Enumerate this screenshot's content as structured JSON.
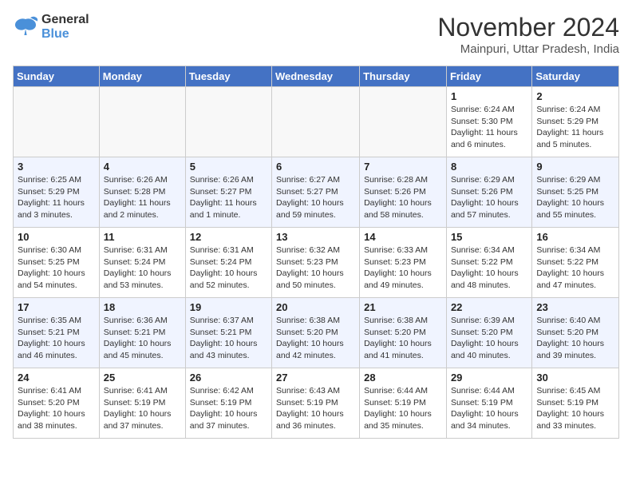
{
  "logo": {
    "line1": "General",
    "line2": "Blue"
  },
  "title": "November 2024",
  "location": "Mainpuri, Uttar Pradesh, India",
  "weekdays": [
    "Sunday",
    "Monday",
    "Tuesday",
    "Wednesday",
    "Thursday",
    "Friday",
    "Saturday"
  ],
  "weeks": [
    [
      {
        "day": "",
        "detail": ""
      },
      {
        "day": "",
        "detail": ""
      },
      {
        "day": "",
        "detail": ""
      },
      {
        "day": "",
        "detail": ""
      },
      {
        "day": "",
        "detail": ""
      },
      {
        "day": "1",
        "detail": "Sunrise: 6:24 AM\nSunset: 5:30 PM\nDaylight: 11 hours and 6 minutes."
      },
      {
        "day": "2",
        "detail": "Sunrise: 6:24 AM\nSunset: 5:29 PM\nDaylight: 11 hours and 5 minutes."
      }
    ],
    [
      {
        "day": "3",
        "detail": "Sunrise: 6:25 AM\nSunset: 5:29 PM\nDaylight: 11 hours and 3 minutes."
      },
      {
        "day": "4",
        "detail": "Sunrise: 6:26 AM\nSunset: 5:28 PM\nDaylight: 11 hours and 2 minutes."
      },
      {
        "day": "5",
        "detail": "Sunrise: 6:26 AM\nSunset: 5:27 PM\nDaylight: 11 hours and 1 minute."
      },
      {
        "day": "6",
        "detail": "Sunrise: 6:27 AM\nSunset: 5:27 PM\nDaylight: 10 hours and 59 minutes."
      },
      {
        "day": "7",
        "detail": "Sunrise: 6:28 AM\nSunset: 5:26 PM\nDaylight: 10 hours and 58 minutes."
      },
      {
        "day": "8",
        "detail": "Sunrise: 6:29 AM\nSunset: 5:26 PM\nDaylight: 10 hours and 57 minutes."
      },
      {
        "day": "9",
        "detail": "Sunrise: 6:29 AM\nSunset: 5:25 PM\nDaylight: 10 hours and 55 minutes."
      }
    ],
    [
      {
        "day": "10",
        "detail": "Sunrise: 6:30 AM\nSunset: 5:25 PM\nDaylight: 10 hours and 54 minutes."
      },
      {
        "day": "11",
        "detail": "Sunrise: 6:31 AM\nSunset: 5:24 PM\nDaylight: 10 hours and 53 minutes."
      },
      {
        "day": "12",
        "detail": "Sunrise: 6:31 AM\nSunset: 5:24 PM\nDaylight: 10 hours and 52 minutes."
      },
      {
        "day": "13",
        "detail": "Sunrise: 6:32 AM\nSunset: 5:23 PM\nDaylight: 10 hours and 50 minutes."
      },
      {
        "day": "14",
        "detail": "Sunrise: 6:33 AM\nSunset: 5:23 PM\nDaylight: 10 hours and 49 minutes."
      },
      {
        "day": "15",
        "detail": "Sunrise: 6:34 AM\nSunset: 5:22 PM\nDaylight: 10 hours and 48 minutes."
      },
      {
        "day": "16",
        "detail": "Sunrise: 6:34 AM\nSunset: 5:22 PM\nDaylight: 10 hours and 47 minutes."
      }
    ],
    [
      {
        "day": "17",
        "detail": "Sunrise: 6:35 AM\nSunset: 5:21 PM\nDaylight: 10 hours and 46 minutes."
      },
      {
        "day": "18",
        "detail": "Sunrise: 6:36 AM\nSunset: 5:21 PM\nDaylight: 10 hours and 45 minutes."
      },
      {
        "day": "19",
        "detail": "Sunrise: 6:37 AM\nSunset: 5:21 PM\nDaylight: 10 hours and 43 minutes."
      },
      {
        "day": "20",
        "detail": "Sunrise: 6:38 AM\nSunset: 5:20 PM\nDaylight: 10 hours and 42 minutes."
      },
      {
        "day": "21",
        "detail": "Sunrise: 6:38 AM\nSunset: 5:20 PM\nDaylight: 10 hours and 41 minutes."
      },
      {
        "day": "22",
        "detail": "Sunrise: 6:39 AM\nSunset: 5:20 PM\nDaylight: 10 hours and 40 minutes."
      },
      {
        "day": "23",
        "detail": "Sunrise: 6:40 AM\nSunset: 5:20 PM\nDaylight: 10 hours and 39 minutes."
      }
    ],
    [
      {
        "day": "24",
        "detail": "Sunrise: 6:41 AM\nSunset: 5:20 PM\nDaylight: 10 hours and 38 minutes."
      },
      {
        "day": "25",
        "detail": "Sunrise: 6:41 AM\nSunset: 5:19 PM\nDaylight: 10 hours and 37 minutes."
      },
      {
        "day": "26",
        "detail": "Sunrise: 6:42 AM\nSunset: 5:19 PM\nDaylight: 10 hours and 37 minutes."
      },
      {
        "day": "27",
        "detail": "Sunrise: 6:43 AM\nSunset: 5:19 PM\nDaylight: 10 hours and 36 minutes."
      },
      {
        "day": "28",
        "detail": "Sunrise: 6:44 AM\nSunset: 5:19 PM\nDaylight: 10 hours and 35 minutes."
      },
      {
        "day": "29",
        "detail": "Sunrise: 6:44 AM\nSunset: 5:19 PM\nDaylight: 10 hours and 34 minutes."
      },
      {
        "day": "30",
        "detail": "Sunrise: 6:45 AM\nSunset: 5:19 PM\nDaylight: 10 hours and 33 minutes."
      }
    ]
  ]
}
